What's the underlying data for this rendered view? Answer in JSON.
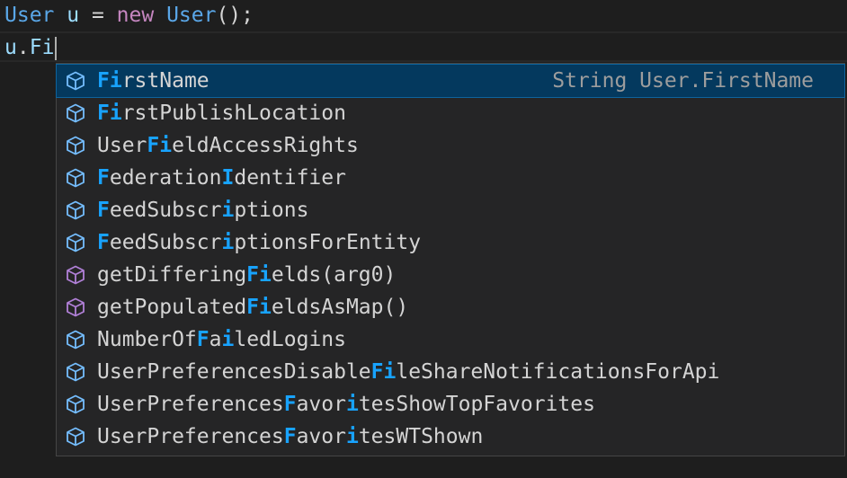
{
  "editor": {
    "line1": {
      "type": "User",
      "var": "u",
      "eq": " = ",
      "kw": "new",
      "ctor": "User",
      "tail": "();"
    },
    "line2": {
      "obj": "u",
      "dot": ".",
      "typed": "Fi"
    }
  },
  "suggestions": {
    "selected_detail": "String User.FirstName",
    "items": [
      {
        "kind": "field-icon",
        "segments": [
          {
            "t": "Fi",
            "h": true
          },
          {
            "t": "rstName",
            "h": false
          }
        ]
      },
      {
        "kind": "field-icon",
        "segments": [
          {
            "t": "Fi",
            "h": true
          },
          {
            "t": "rstPublishLocation",
            "h": false
          }
        ]
      },
      {
        "kind": "field-icon",
        "segments": [
          {
            "t": "User",
            "h": false
          },
          {
            "t": "Fi",
            "h": true
          },
          {
            "t": "eldAccessRights",
            "h": false
          }
        ]
      },
      {
        "kind": "field-icon",
        "segments": [
          {
            "t": "F",
            "h": true
          },
          {
            "t": "ederation",
            "h": false
          },
          {
            "t": "I",
            "h": true
          },
          {
            "t": "dentifier",
            "h": false
          }
        ]
      },
      {
        "kind": "field-icon",
        "segments": [
          {
            "t": "F",
            "h": true
          },
          {
            "t": "eedSubscr",
            "h": false
          },
          {
            "t": "i",
            "h": true
          },
          {
            "t": "ptions",
            "h": false
          }
        ]
      },
      {
        "kind": "field-icon",
        "segments": [
          {
            "t": "F",
            "h": true
          },
          {
            "t": "eedSubscr",
            "h": false
          },
          {
            "t": "i",
            "h": true
          },
          {
            "t": "ptionsForEntity",
            "h": false
          }
        ]
      },
      {
        "kind": "method-icon",
        "segments": [
          {
            "t": "getDiffering",
            "h": false
          },
          {
            "t": "Fi",
            "h": true
          },
          {
            "t": "elds(arg0)",
            "h": false
          }
        ]
      },
      {
        "kind": "method-icon",
        "segments": [
          {
            "t": "getPopulated",
            "h": false
          },
          {
            "t": "Fi",
            "h": true
          },
          {
            "t": "eldsAsMap()",
            "h": false
          }
        ]
      },
      {
        "kind": "field-icon",
        "segments": [
          {
            "t": "NumberOf",
            "h": false
          },
          {
            "t": "F",
            "h": true
          },
          {
            "t": "a",
            "h": false
          },
          {
            "t": "i",
            "h": true
          },
          {
            "t": "ledLogins",
            "h": false
          }
        ]
      },
      {
        "kind": "field-icon",
        "segments": [
          {
            "t": "UserPreferencesDisable",
            "h": false
          },
          {
            "t": "Fi",
            "h": true
          },
          {
            "t": "leShareNotificationsForApi",
            "h": false
          }
        ]
      },
      {
        "kind": "field-icon",
        "segments": [
          {
            "t": "UserPreferences",
            "h": false
          },
          {
            "t": "F",
            "h": true
          },
          {
            "t": "avor",
            "h": false
          },
          {
            "t": "i",
            "h": true
          },
          {
            "t": "tesShowTopFavorites",
            "h": false
          }
        ]
      },
      {
        "kind": "field-icon",
        "segments": [
          {
            "t": "UserPreferences",
            "h": false
          },
          {
            "t": "F",
            "h": true
          },
          {
            "t": "avor",
            "h": false
          },
          {
            "t": "i",
            "h": true
          },
          {
            "t": "tesWTShown",
            "h": false
          }
        ]
      }
    ]
  },
  "colors": {
    "field_icon": "#75beff",
    "method_icon": "#b180d7",
    "highlight": "#18a3ff",
    "selected_bg": "#04395e"
  }
}
